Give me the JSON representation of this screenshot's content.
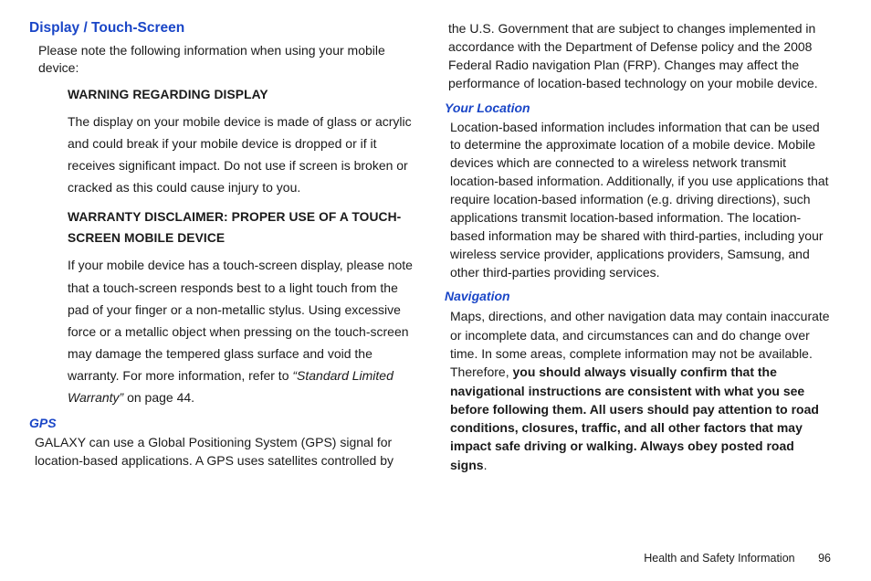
{
  "col1": {
    "heading_display": "Display / Touch-Screen",
    "lead": "Please note the following information when using your mobile device:",
    "warn_head": "WARNING REGARDING DISPLAY",
    "warn_para": "The display on your mobile device is made of glass or acrylic and could break if your mobile device is dropped or if it receives significant impact. Do not use if screen is broken or cracked as this could cause injury to you.",
    "disc_head": "WARRANTY DISCLAIMER: PROPER USE OF A TOUCH-SCREEN MOBILE DEVICE",
    "disc_para_1": "If your mobile device has a touch-screen display, please note that a touch-screen responds best to a light touch from the pad of your finger or a non-metallic stylus. Using excessive force or a metallic object when pressing on the touch-screen may damage the tempered glass surface and void the warranty. For more information, refer to ",
    "disc_ref": "“Standard Limited Warranty”",
    "disc_tail": "  on page 44.",
    "gps_head": "GPS",
    "gps_para": "GALAXY can use a Global Positioning System (GPS) signal for location-based applications. A GPS uses satellites controlled by"
  },
  "col2": {
    "cont": "the U.S. Government that are subject to changes implemented in accordance with the Department of Defense policy and the 2008 Federal Radio navigation Plan (FRP). Changes may affect the performance of location-based technology on your mobile device.",
    "loc_head": "Your Location",
    "loc_para": "Location-based information includes information that can be used to determine the approximate location of a mobile device. Mobile devices which are connected to a wireless network transmit location-based information. Additionally, if you use applications that require location-based information (e.g. driving directions), such applications transmit location-based information. The location-based information may be shared with third-parties, including your wireless service provider, applications providers, Samsung, and other third-parties providing services.",
    "nav_head": "Navigation",
    "nav_para_1": "Maps, directions, and other navigation data may contain inaccurate or incomplete data, and circumstances can and do change over time. In some areas, complete information may not be available. Therefore,  ",
    "nav_bold": "you should always visually confirm that the navigational instructions are consistent with what you see before following them. All users should pay attention to road conditions, closures, traffic, and all other factors that may impact safe driving or walking. Always obey posted road signs",
    "nav_tail": "."
  },
  "footer": {
    "section": "Health and Safety Information",
    "page": "96"
  }
}
